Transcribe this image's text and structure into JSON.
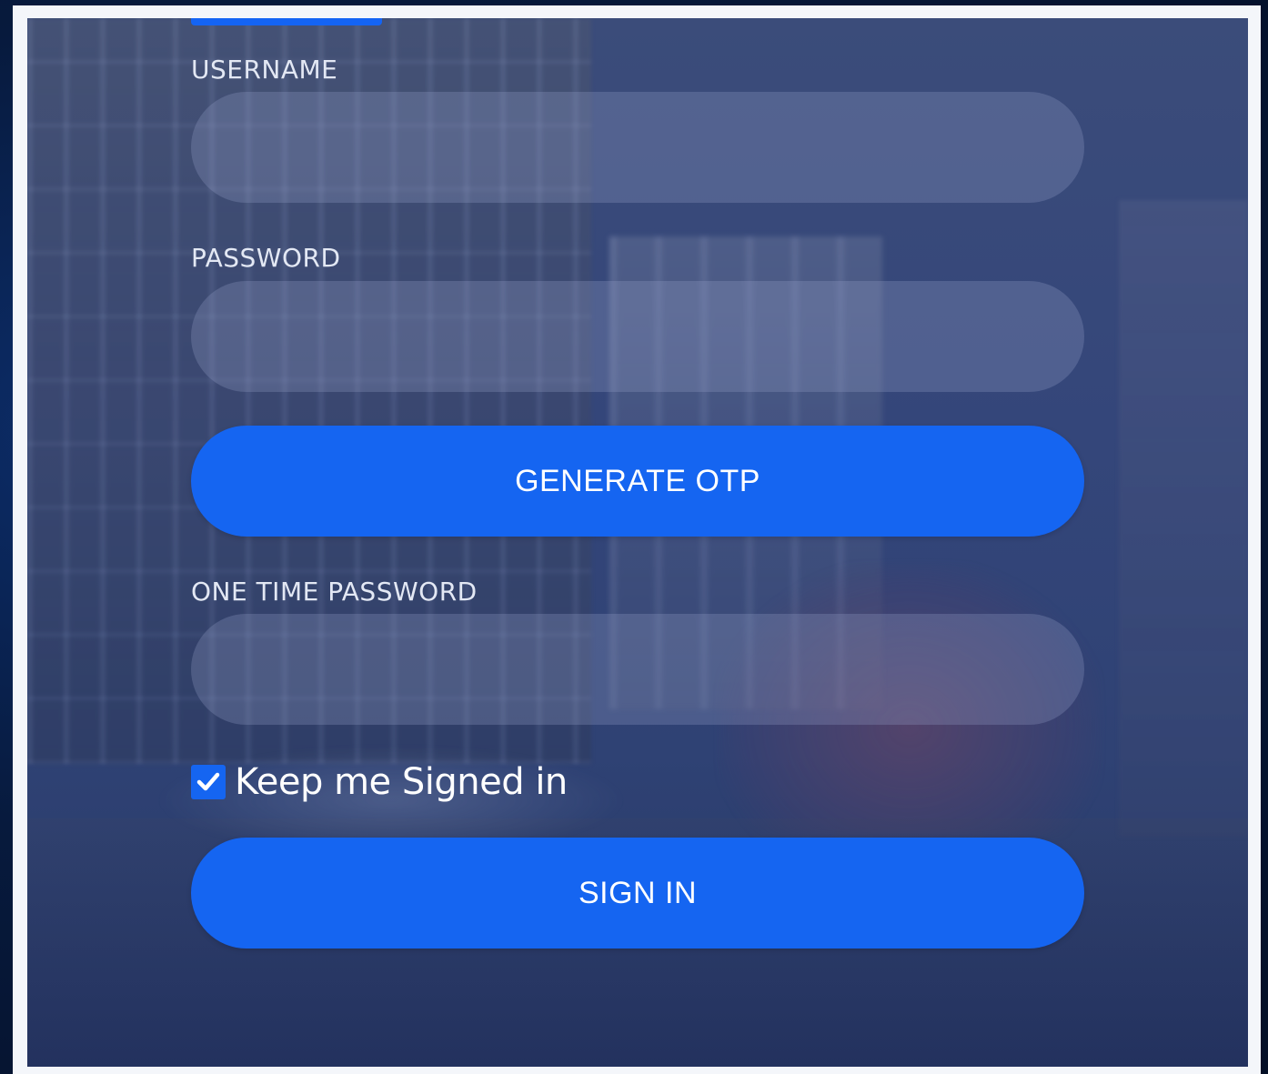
{
  "form": {
    "username_label": "USERNAME",
    "username_value": "",
    "password_label": "PASSWORD",
    "password_value": "",
    "generate_otp_label": "GENERATE OTP",
    "otp_label": "ONE TIME PASSWORD",
    "otp_value": "",
    "keep_signed_in_label": "Keep me Signed in",
    "keep_signed_in_checked": true,
    "sign_in_label": "SIGN IN"
  },
  "icons": {
    "checkbox": "checkmark-icon"
  },
  "colors": {
    "accent": "#1565f1",
    "panel_overlay": "#34467a",
    "label_text": "#e3e8f4",
    "outer_background": "#061733"
  }
}
